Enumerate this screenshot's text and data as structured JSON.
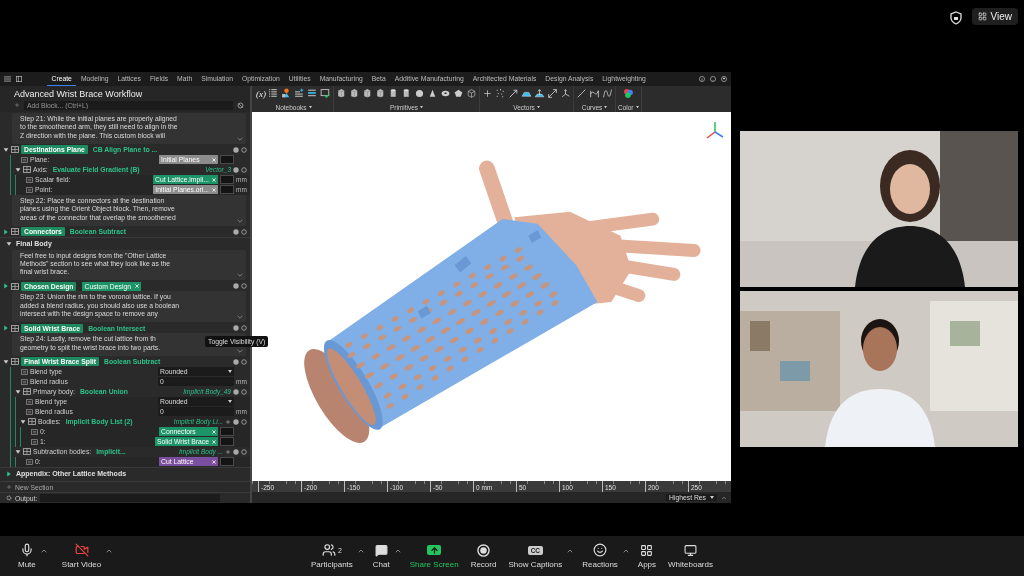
{
  "top_bar": {
    "view_button": "View"
  },
  "shared_screen": {
    "app_tabs": [
      {
        "label": "Create",
        "selected": true
      },
      {
        "label": "Modeling",
        "selected": false
      },
      {
        "label": "Lattices",
        "selected": false
      },
      {
        "label": "Fields",
        "selected": false
      },
      {
        "label": "Math",
        "selected": false
      },
      {
        "label": "Simulation",
        "selected": false
      },
      {
        "label": "Optimization",
        "selected": false
      },
      {
        "label": "Utilities",
        "selected": false
      },
      {
        "label": "Manufacturing",
        "selected": false
      },
      {
        "label": "Beta",
        "selected": false
      },
      {
        "label": "Additive Manufacturing",
        "selected": false
      },
      {
        "label": "Architected Materials",
        "selected": false
      },
      {
        "label": "Design Analysis",
        "selected": false
      },
      {
        "label": "Lightweighting",
        "selected": false
      }
    ],
    "notebook_title": "Advanced Wrist Brace Workflow",
    "add_block_placeholder": "Add Block... (Ctrl+L)",
    "variable_button": "(x)",
    "ribbon_groups": [
      {
        "label": "Notebooks"
      },
      {
        "label": "Primitives"
      },
      {
        "label": "Vectors"
      },
      {
        "label": "Curves"
      },
      {
        "label": "Color"
      }
    ],
    "notebook": [
      {
        "kind": "note",
        "lines": [
          "Step 21: While the initial planes are properly aligned",
          "to the smoothened arm, they still need to align in the",
          "Z direction with the plane. This custom block will"
        ]
      },
      {
        "kind": "block",
        "name": "Destinations Plane",
        "type": "CB Align Plane to ...",
        "expanded": true,
        "children": [
          {
            "kind": "input",
            "label": "Plane:",
            "value": "Initial Planes",
            "color": "#8c8c8c"
          },
          {
            "kind": "sub_block",
            "label": "Axis:",
            "type": "Evaluate Field Gradient (B)",
            "output": "Vector_3",
            "expanded": true,
            "children": [
              {
                "kind": "input",
                "label": "Scalar field:",
                "value": "Cut Lattice.impli...",
                "color": "#1d9468",
                "unit": "mm"
              },
              {
                "kind": "input",
                "label": "Point:",
                "value": "Initial Planes.ori...",
                "color": "#8c8c8c",
                "unit": "mm"
              }
            ]
          }
        ]
      },
      {
        "kind": "note",
        "lines": [
          "Step 22: Place the connectors at the destination",
          "planes using the Orient Object block. Then, remove",
          "areas of the connector that overlap the smoothened"
        ]
      },
      {
        "kind": "block",
        "name": "Connectors",
        "type": "Boolean Subtract",
        "expanded": false
      },
      {
        "kind": "section",
        "title": "Final Body",
        "expanded": true
      },
      {
        "kind": "note",
        "lines": [
          "Feel free to input designs from the \"Other Lattice",
          "Methods\" section to see what they look like as the",
          "final wrist brace."
        ]
      },
      {
        "kind": "block",
        "name": "Chosen Design",
        "value": "Custom Design",
        "color": "#1d9468",
        "expanded": false
      },
      {
        "kind": "note",
        "lines": [
          "Step 23: Union the rim to the voronoi lattice. If you",
          "added a blend radius, you should also use a boolean",
          "intersect with the design space to remove any"
        ]
      },
      {
        "kind": "block",
        "name": "Solid Wrist Brace",
        "type": "Boolean Intersect",
        "expanded": false
      },
      {
        "kind": "note",
        "lines": [
          "Step 24: Lastly, remove the cut lattice from th",
          "geometry to split the wrist brace into two parts."
        ]
      },
      {
        "kind": "block",
        "name": "Final Wrist Brace Split",
        "type": "Boolean Subtract",
        "expanded": true,
        "children": [
          {
            "kind": "dropdown",
            "label": "Blend type",
            "value": "Rounded"
          },
          {
            "kind": "input",
            "label": "Blend radius",
            "value": "0",
            "unit": "mm"
          },
          {
            "kind": "sub_block",
            "label": "Primary body:",
            "type": "Boolean Union",
            "output": "Implicit Body_49",
            "expanded": true,
            "children": [
              {
                "kind": "dropdown",
                "label": "Blend type",
                "value": "Rounded"
              },
              {
                "kind": "input",
                "label": "Blend radius",
                "value": "0",
                "unit": "mm"
              },
              {
                "kind": "sub_block",
                "label": "Bodies:",
                "type": "Implicit Body List (2)",
                "output": "Implicit Body Li...",
                "addable": true,
                "expanded": true,
                "children": [
                  {
                    "kind": "input",
                    "label": "0:",
                    "value": "Connectors",
                    "color": "#1d9468"
                  },
                  {
                    "kind": "input",
                    "label": "1:",
                    "value": "Solid Wrist Brace",
                    "color": "#1d9468"
                  }
                ]
              }
            ]
          },
          {
            "kind": "sub_block",
            "label": "Subtraction bodies:",
            "type": "Implicit...",
            "output": "Implicit Body ...",
            "addable": true,
            "expanded": true,
            "children": [
              {
                "kind": "input",
                "label": "0:",
                "value": "Cut Lattice",
                "color": "#7c4f9e"
              }
            ]
          }
        ]
      },
      {
        "kind": "section",
        "title": "Appendix: Other Lattice Methods",
        "expanded": false
      }
    ],
    "new_section": "New Section",
    "output_label": "Output:",
    "tooltip": "Toggle Visibility (V)",
    "ruler_labels": [
      "-250",
      "-200",
      "-150",
      "-100",
      "-50",
      "0 mm",
      "50",
      "100",
      "150",
      "200",
      "250"
    ],
    "render_quality": "Highest Res"
  },
  "meeting_controls": {
    "left": [
      {
        "kind": "mic",
        "label": "Mute",
        "caret": true
      },
      {
        "kind": "video_off",
        "label": "Start Video",
        "caret": true
      }
    ],
    "center": [
      {
        "kind": "participants",
        "label": "Participants",
        "count": "2",
        "caret": true
      },
      {
        "kind": "chat",
        "label": "Chat",
        "caret": true
      },
      {
        "kind": "share",
        "label": "Share Screen",
        "caret": false
      },
      {
        "kind": "record",
        "label": "Record",
        "caret": false
      },
      {
        "kind": "captions",
        "label": "Show Captions",
        "icon_text": "CC",
        "caret": true
      },
      {
        "kind": "reactions",
        "label": "Reactions",
        "caret": true
      },
      {
        "kind": "apps",
        "label": "Apps",
        "caret": false
      },
      {
        "kind": "whiteboards",
        "label": "Whiteboards",
        "caret": false
      }
    ]
  }
}
